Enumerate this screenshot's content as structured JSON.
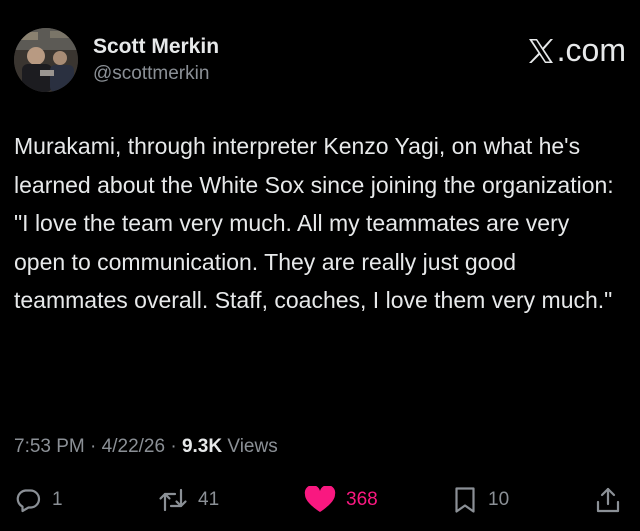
{
  "author": {
    "display_name": "Scott Merkin",
    "handle": "@scottmerkin",
    "avatar_icon": "avatar-photo"
  },
  "brand": {
    "label": ".com",
    "icon": "x-logo-icon"
  },
  "tweet": {
    "text": "Murakami, through interpreter Kenzo Yagi, on what he's learned about the White Sox since joining the organization: \"I love the team very much. All my teammates are very open to communication. They are really just good teammates overall. Staff, coaches, I love them very much.\""
  },
  "meta": {
    "time": "7:53 PM",
    "separator": "·",
    "date": "4/22/26",
    "views_count": "9.3K",
    "views_label": "Views"
  },
  "actions": {
    "replies": "1",
    "reposts": "41",
    "likes": "368",
    "bookmarks": "10"
  },
  "colors": {
    "background": "#000000",
    "text_primary": "#e7e9ea",
    "text_secondary": "#8b9096",
    "like_accent": "#f91880"
  }
}
